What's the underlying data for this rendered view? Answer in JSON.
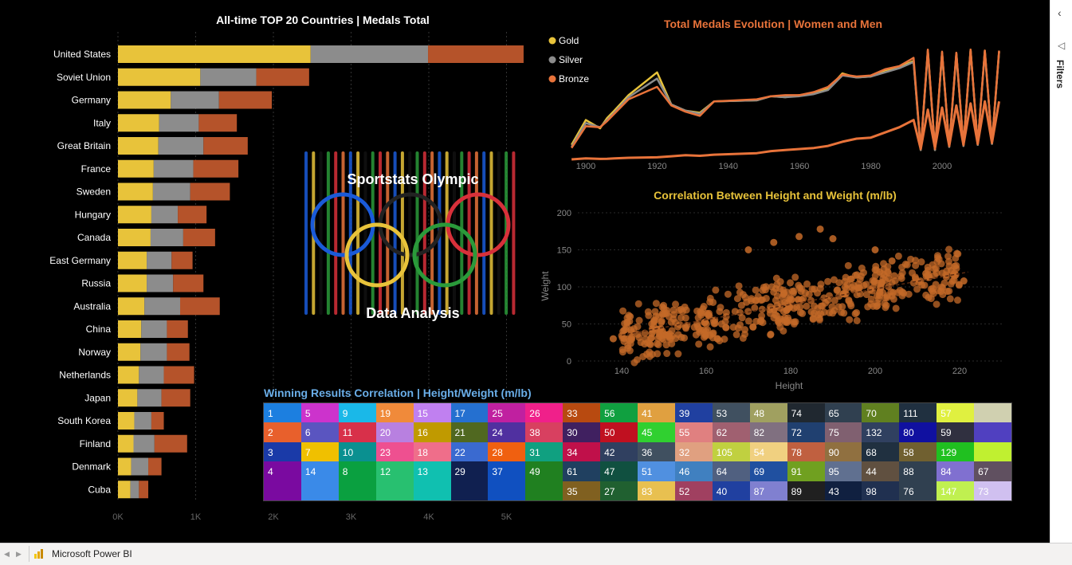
{
  "report": {
    "bar_title": "All-time TOP 20 Countries | Medals Total",
    "line_title": "Total Medals Evolution | Women and Men",
    "scatter_title": "Correlation Between Height and Weight (m/lb)",
    "treemap_title": "Winning Results Correlation | Height/Weight (m/lb)",
    "logo_line1": "Sportstats Olympic",
    "logo_line2": "Data Analysis"
  },
  "colors": {
    "gold": "#e8c33a",
    "silver": "#8c8c8c",
    "bronze": "#b5532a",
    "orange": "#e8733a",
    "scatter": "#c46a28",
    "accent_blue": "#6aaee8"
  },
  "side": {
    "filters_label": "Filters"
  },
  "taskbar": {
    "app_name": "Microsoft Power BI"
  },
  "chart_data": [
    {
      "type": "bar",
      "title": "All-time TOP 20 Countries | Medals Total",
      "categories": [
        "United States",
        "Soviet Union",
        "Germany",
        "Italy",
        "Great Britain",
        "France",
        "Sweden",
        "Hungary",
        "Canada",
        "East Germany",
        "Russia",
        "Australia",
        "China",
        "Norway",
        "Netherlands",
        "Japan",
        "South Korea",
        "Finland",
        "Denmark",
        "Cuba"
      ],
      "series": [
        {
          "name": "Gold",
          "values": [
            2480,
            1060,
            680,
            530,
            520,
            460,
            450,
            430,
            420,
            370,
            370,
            340,
            300,
            290,
            270,
            250,
            210,
            200,
            170,
            160
          ]
        },
        {
          "name": "Silver",
          "values": [
            1510,
            720,
            620,
            510,
            580,
            510,
            480,
            340,
            420,
            320,
            340,
            460,
            330,
            340,
            320,
            310,
            220,
            270,
            220,
            110
          ]
        },
        {
          "name": "Bronze",
          "values": [
            1230,
            680,
            680,
            490,
            570,
            580,
            510,
            370,
            410,
            270,
            390,
            510,
            270,
            290,
            390,
            370,
            160,
            420,
            170,
            120
          ]
        }
      ],
      "xticks": [
        "0K",
        "1K",
        "2K",
        "3K",
        "4K",
        "5K"
      ],
      "xlim": [
        0,
        5200
      ]
    },
    {
      "type": "line",
      "title": "Total Medals Evolution | Women and Men",
      "legend": [
        "Gold",
        "Silver",
        "Bronze"
      ],
      "xticks": [
        "1900",
        "1920",
        "1940",
        "1960",
        "1980",
        "2000"
      ],
      "x": [
        1896,
        1900,
        1904,
        1906,
        1908,
        1912,
        1920,
        1924,
        1928,
        1932,
        1936,
        1948,
        1952,
        1956,
        1960,
        1964,
        1968,
        1972,
        1976,
        1980,
        1984,
        1988,
        1992,
        1994,
        1996,
        1998,
        2000,
        2002,
        2004,
        2006,
        2008,
        2010,
        2012,
        2014,
        2016
      ],
      "series": [
        {
          "name": "Gold",
          "values": [
            140,
            380,
            300,
            400,
            470,
            620,
            840,
            530,
            470,
            450,
            560,
            570,
            610,
            600,
            620,
            640,
            680,
            830,
            790,
            800,
            860,
            890,
            950,
            90,
            1050,
            90,
            1030,
            120,
            1020,
            130,
            1060,
            140,
            1050,
            150,
            1040
          ]
        },
        {
          "name": "Silver",
          "values": [
            120,
            350,
            310,
            380,
            450,
            600,
            780,
            530,
            470,
            440,
            560,
            570,
            610,
            600,
            610,
            630,
            670,
            810,
            790,
            800,
            840,
            880,
            940,
            90,
            1040,
            90,
            1030,
            120,
            1020,
            130,
            1050,
            140,
            1040,
            150,
            1040
          ]
        },
        {
          "name": "Bronze",
          "values": [
            110,
            320,
            310,
            370,
            440,
            580,
            700,
            520,
            460,
            420,
            560,
            580,
            610,
            620,
            620,
            650,
            700,
            820,
            800,
            810,
            870,
            900,
            980,
            100,
            1060,
            100,
            1040,
            130,
            1030,
            140,
            1060,
            150,
            1050,
            160,
            1050
          ]
        },
        {
          "name": "Women",
          "values": [
            0,
            10,
            5,
            6,
            10,
            15,
            20,
            30,
            40,
            35,
            45,
            60,
            80,
            90,
            100,
            110,
            130,
            170,
            200,
            210,
            260,
            310,
            380,
            100,
            480,
            110,
            500,
            130,
            520,
            140,
            540,
            150,
            560,
            160,
            560
          ]
        }
      ]
    },
    {
      "type": "scatter",
      "title": "Correlation Between Height and Weight (m/lb)",
      "xlabel": "Height",
      "ylabel": "Weight",
      "xticks": [
        "140",
        "160",
        "180",
        "200",
        "220"
      ],
      "yticks": [
        "0",
        "50",
        "100",
        "150",
        "200"
      ],
      "xlim": [
        130,
        230
      ],
      "ylim": [
        0,
        200
      ],
      "trend": [
        [
          140,
          35
        ],
        [
          222,
          120
        ]
      ]
    }
  ],
  "treemap": {
    "columns": [
      [
        "1",
        "2",
        "3",
        "4"
      ],
      [
        "5",
        "6",
        "7",
        "14"
      ],
      [
        "9",
        "11",
        "10",
        "8"
      ],
      [
        "19",
        "20",
        "23",
        "12"
      ],
      [
        "15",
        "16",
        "18",
        "13"
      ],
      [
        "17",
        "21",
        "22",
        "29"
      ],
      [
        "25",
        "24",
        "28",
        "37"
      ],
      [
        "26",
        "38",
        "31",
        "49"
      ],
      [
        "33",
        "30",
        "34",
        "61",
        "35"
      ],
      [
        "56",
        "50",
        "42",
        "47",
        "27"
      ],
      [
        "41",
        "45",
        "36",
        "51",
        "83"
      ],
      [
        "39",
        "55",
        "32",
        "46",
        "52"
      ],
      [
        "53",
        "62",
        "105",
        "64",
        "40"
      ],
      [
        "48",
        "82",
        "54",
        "69",
        "87"
      ],
      [
        "74",
        "72",
        "78",
        "91",
        "89"
      ],
      [
        "65",
        "75",
        "90",
        "95",
        "43"
      ],
      [
        "70",
        "132",
        "68",
        "44",
        "98"
      ],
      [
        "111",
        "80",
        "58",
        "88",
        "76"
      ],
      [
        "57",
        "59",
        "129",
        "84",
        "147"
      ],
      [
        "",
        "",
        "",
        "67",
        "73"
      ]
    ],
    "colors": [
      [
        "#1c7fe0",
        "#e8602c",
        "#1a3aa8",
        "#7a0aa0"
      ],
      [
        "#cc33cc",
        "#5a55c0",
        "#f0c000",
        "#3a8ae8"
      ],
      [
        "#1ab8e8",
        "#d8304a",
        "#0a9090",
        "#0aa040"
      ],
      [
        "#f08a3a",
        "#b880e0",
        "#ee5090",
        "#28c070"
      ],
      [
        "#c080f0",
        "#c09a00",
        "#ef6e8a",
        "#10c0b0"
      ],
      [
        "#2570d0",
        "#506820",
        "#3a6ad0",
        "#102050"
      ],
      [
        "#c020a0",
        "#5030a0",
        "#f06010",
        "#1050c0"
      ],
      [
        "#f0208a",
        "#d84060",
        "#10a080",
        "#208020"
      ],
      [
        "#b84a10",
        "#402060",
        "#c0104a",
        "#204060",
        "#806020"
      ],
      [
        "#10a040",
        "#c01020",
        "#304060",
        "#105040",
        "#206030"
      ],
      [
        "#e0a040",
        "#30d030",
        "#405060",
        "#5090e0",
        "#e8c050"
      ],
      [
        "#2040a0",
        "#e08080",
        "#e0a080",
        "#4080c0",
        "#a04060"
      ],
      [
        "#405060",
        "#a06070",
        "#c0d040",
        "#506080",
        "#2040a0"
      ],
      [
        "#a0a060",
        "#807080",
        "#f0d080",
        "#2050a0",
        "#8080d0"
      ],
      [
        "#202830",
        "#204070",
        "#c06040",
        "#70a020",
        "#202020"
      ],
      [
        "#304050",
        "#806070",
        "#907040",
        "#607090",
        "#102040"
      ],
      [
        "#608020",
        "#304060",
        "#203040",
        "#605040",
        "#203050"
      ],
      [
        "#203040",
        "#1010a0",
        "#706030",
        "#304050",
        "#304050"
      ],
      [
        "#e0f040",
        "#303040",
        "#20c020",
        "#8070d0",
        "#c0f050"
      ],
      [
        "#d0d0b0",
        "#5040c0",
        "#c0f030",
        "#605060",
        "#d0c0f0"
      ]
    ],
    "extra_colors": [
      "#a07060",
      "#4060d0",
      "#60e060",
      "#e0f060",
      "#c0e060"
    ]
  }
}
